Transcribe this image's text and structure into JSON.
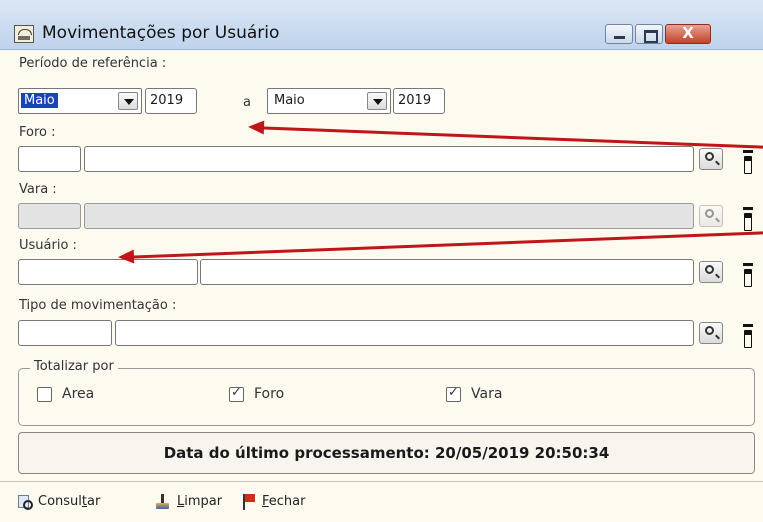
{
  "window": {
    "title": "Movimentações por Usuário",
    "close_label": "X"
  },
  "periodo": {
    "label": "Período de referência :",
    "start_month": "Maio",
    "start_year": "2019",
    "separator": "a",
    "end_month": "Maio",
    "end_year": "2019"
  },
  "foro": {
    "label": "Foro :",
    "code": "",
    "name": ""
  },
  "vara": {
    "label": "Vara :",
    "code": "",
    "name": ""
  },
  "usuario": {
    "label": "Usuário :",
    "code": "",
    "name": ""
  },
  "tipo": {
    "label": "Tipo de movimentação :",
    "code": "",
    "name": ""
  },
  "totalizar": {
    "title": "Totalizar por",
    "options": [
      {
        "label": "Area",
        "checked": false
      },
      {
        "label": "Foro",
        "checked": true
      },
      {
        "label": "Vara",
        "checked": true
      }
    ]
  },
  "info": {
    "text": "Data do último processamento: 20/05/2019 20:50:34"
  },
  "toolbar": {
    "consultar": {
      "pre": "Consul",
      "key": "t",
      "post": "ar"
    },
    "limpar": {
      "pre": "",
      "key": "L",
      "post": "impar"
    },
    "fechar": {
      "pre": "",
      "key": "F",
      "post": "echar"
    }
  },
  "colors": {
    "annotation_arrow": "#c0161a",
    "selection": "#1a44b6"
  }
}
